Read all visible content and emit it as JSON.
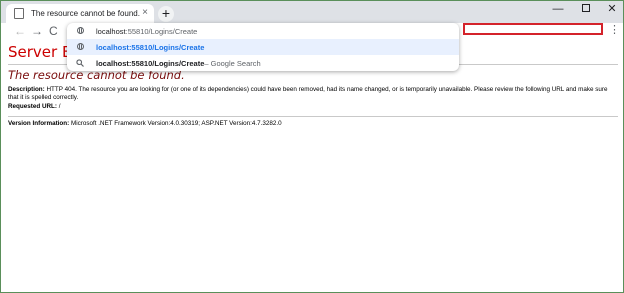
{
  "tabs": [
    {
      "title": "The resource cannot be found.",
      "close_icon": "×"
    }
  ],
  "new_tab_label": "+",
  "window_controls": {
    "minimize": "—",
    "close": "✕"
  },
  "toolbar": {
    "back": "←",
    "forward": "→",
    "reload": "C",
    "menu": "⋮"
  },
  "omnibox": {
    "suggestions": [
      {
        "icon": "globe-icon",
        "host": "localhost",
        "path": ":55810/Logins/Create",
        "suffix": ""
      },
      {
        "icon": "globe-icon",
        "host": "localhost",
        "path": ":55810/Logins/Create",
        "suffix": "",
        "selected": true
      },
      {
        "icon": "search-icon",
        "host": "localhost:55810/Logins/Create",
        "path": "",
        "suffix": " – Google Search"
      }
    ]
  },
  "page": {
    "title": "Server Error in '/' Application.",
    "subtitle": "The resource cannot be found.",
    "description_label": "Description:",
    "description_text": " HTTP 404. The resource you are looking for (or one of its dependencies) could have been removed, had its name changed, or is temporarily unavailable.  Please review the following URL and make sure that it is spelled correctly.",
    "requested_url_label": "Requested URL:",
    "requested_url_value": " /",
    "version_label": "Version Information:",
    "version_text": " Microsoft .NET Framework Version:4.0.30319; ASP.NET Version:4.7.3282.0"
  },
  "colors": {
    "error_title": "#cc0000",
    "error_subtitle": "#7a0d0d",
    "highlight": "#d4232b",
    "selected_row": "#e8f0fe"
  }
}
